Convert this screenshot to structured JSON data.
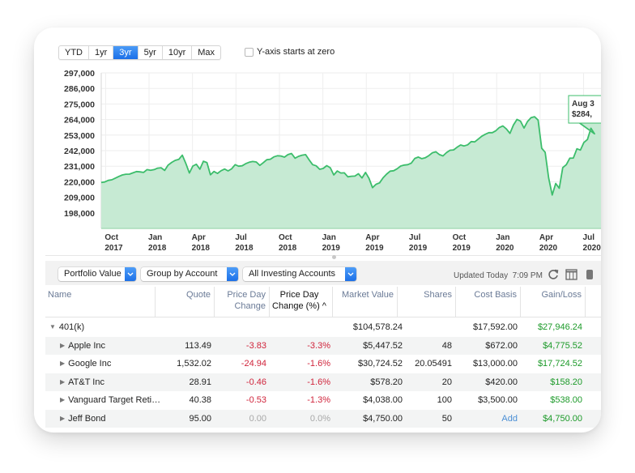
{
  "range_control": {
    "options": [
      "YTD",
      "1yr",
      "3yr",
      "5yr",
      "10yr",
      "Max"
    ],
    "selected": "3yr"
  },
  "y_axis_zero": {
    "label": "Y-axis starts at zero",
    "checked": false
  },
  "tooltip": {
    "date": "Aug 3",
    "value": "$284,"
  },
  "colors": {
    "line": "#3cbd6b",
    "fill": "#c6ead3",
    "accent": "#1a6fe8",
    "negative": "#d0243b",
    "positive": "#1c9a29"
  },
  "chart_data": {
    "type": "area",
    "title": "",
    "xlabel": "",
    "ylabel": "Portfolio Value",
    "ylim": [
      187000,
      297000
    ],
    "y_ticks": [
      "297,000",
      "286,000",
      "275,000",
      "264,000",
      "253,000",
      "242,000",
      "231,000",
      "220,000",
      "209,000",
      "198,000"
    ],
    "y_tick_values": [
      297000,
      286000,
      275000,
      264000,
      253000,
      242000,
      231000,
      220000,
      209000,
      198000
    ],
    "x_ticks": [
      {
        "month": "Oct",
        "year": "2017"
      },
      {
        "month": "Jan",
        "year": "2018"
      },
      {
        "month": "Apr",
        "year": "2018"
      },
      {
        "month": "Jul",
        "year": "2018"
      },
      {
        "month": "Oct",
        "year": "2018"
      },
      {
        "month": "Jan",
        "year": "2019"
      },
      {
        "month": "Apr",
        "year": "2019"
      },
      {
        "month": "Jul",
        "year": "2019"
      },
      {
        "month": "Oct",
        "year": "2019"
      },
      {
        "month": "Jan",
        "year": "2020"
      },
      {
        "month": "Apr",
        "year": "2020"
      },
      {
        "month": "Jul",
        "year": "2020"
      }
    ],
    "grid": true,
    "series": [
      {
        "name": "Portfolio Value",
        "x_months": [
          0,
          0.25,
          0.5,
          0.75,
          1,
          1.25,
          1.5,
          1.75,
          2,
          2.25,
          2.5,
          2.75,
          3,
          3.25,
          3.5,
          3.75,
          4,
          4.25,
          4.5,
          4.75,
          5,
          5.25,
          5.5,
          5.75,
          6,
          6.25,
          6.5,
          6.75,
          7,
          7.25,
          7.5,
          7.75,
          8,
          8.25,
          8.5,
          8.75,
          9,
          9.25,
          9.5,
          9.75,
          10,
          10.25,
          10.5,
          10.75,
          11,
          11.25,
          11.5,
          11.75,
          12,
          12.25,
          12.5,
          12.75,
          13,
          13.25,
          13.5,
          13.75,
          14,
          14.25,
          14.5,
          14.75,
          15,
          15.25,
          15.5,
          15.75,
          16,
          16.25,
          16.5,
          16.75,
          17,
          17.25,
          17.5,
          17.75,
          18,
          18.25,
          18.5,
          18.75,
          19,
          19.25,
          19.5,
          19.75,
          20,
          20.25,
          20.5,
          20.75,
          21,
          21.25,
          21.5,
          21.75,
          22,
          22.25,
          22.5,
          22.75,
          23,
          23.25,
          23.5,
          23.75,
          24,
          24.25,
          24.5,
          24.75,
          25,
          25.25,
          25.5,
          25.75,
          26,
          26.25,
          26.5,
          26.75,
          27,
          27.25,
          27.5,
          27.75,
          28,
          28.25,
          28.5,
          28.75,
          29,
          29.25,
          29.5,
          29.75,
          30,
          30.25,
          30.5,
          30.75,
          31,
          31.25,
          31.5,
          31.75,
          32,
          32.25,
          32.5,
          32.75,
          33,
          33.25,
          33.5,
          33.75,
          34,
          34.25,
          34.5,
          34.75,
          35,
          35.25,
          35.5,
          35.75
        ],
        "values": [
          219500,
          219800,
          221000,
          221400,
          222600,
          223800,
          224800,
          225300,
          225400,
          226300,
          227200,
          227000,
          226600,
          228600,
          228100,
          228600,
          229600,
          229900,
          228000,
          231800,
          233700,
          235100,
          235800,
          238800,
          233000,
          226200,
          231100,
          232400,
          228900,
          234500,
          233600,
          224900,
          227300,
          225900,
          227800,
          229000,
          227700,
          229100,
          232100,
          231000,
          231300,
          232800,
          233800,
          234300,
          234000,
          231600,
          233500,
          235600,
          235900,
          237600,
          238400,
          238200,
          237400,
          239200,
          240000,
          236700,
          238000,
          238800,
          239200,
          235500,
          232100,
          231300,
          228800,
          229400,
          231400,
          229900,
          224800,
          227600,
          226200,
          226300,
          223500,
          223900,
          224000,
          225700,
          222700,
          226600,
          222400,
          215800,
          218200,
          219200,
          222800,
          225400,
          227500,
          227800,
          229200,
          231100,
          231800,
          232100,
          233200,
          236500,
          237500,
          236300,
          237000,
          238500,
          240500,
          241200,
          239200,
          238300,
          240600,
          242300,
          242500,
          244400,
          246000,
          245300,
          246100,
          248400,
          248200,
          250200,
          252200,
          253600,
          254700,
          254700,
          256100,
          258400,
          259500,
          257300,
          254200,
          260100,
          264100,
          262900,
          258000,
          262600,
          265300,
          266000,
          263600,
          243700,
          240800,
          222700,
          210600,
          218800,
          215400,
          230000,
          232100,
          236700,
          236800,
          243300,
          242400,
          247800,
          249900,
          257800,
          253900
        ],
        "range_end_value_label": "$284,"
      }
    ]
  },
  "toolbar": {
    "view_select": "Portfolio Value",
    "group_select": "Group by Account",
    "accounts_select": "All Investing Accounts",
    "updated_label": "Updated Today",
    "updated_time": "7:09 PM"
  },
  "table": {
    "columns": [
      {
        "key": "name",
        "label": "Name",
        "line2": ""
      },
      {
        "key": "quote",
        "label": "Quote",
        "line2": ""
      },
      {
        "key": "chg",
        "label": "Price Day",
        "line2": "Change"
      },
      {
        "key": "chgp",
        "label": "Price Day",
        "line2": "Change (%) ^"
      },
      {
        "key": "mv",
        "label": "Market Value",
        "line2": ""
      },
      {
        "key": "shares",
        "label": "Shares",
        "line2": ""
      },
      {
        "key": "cost",
        "label": "Cost Basis",
        "line2": ""
      },
      {
        "key": "gain",
        "label": "Gain/Loss",
        "line2": ""
      }
    ],
    "sorted_column": "chgp",
    "group": {
      "name": "401(k)",
      "market_value": "$104,578.24",
      "cost_basis": "$17,592.00",
      "gain_loss": "$27,946.24"
    },
    "rows": [
      {
        "name": "Apple Inc",
        "quote": "113.49",
        "chg": "-3.83",
        "chgp": "-3.3%",
        "mv": "$5,447.52",
        "shares": "48",
        "cost": "$672.00",
        "gain": "$4,775.52"
      },
      {
        "name": "Google Inc",
        "quote": "1,532.02",
        "chg": "-24.94",
        "chgp": "-1.6%",
        "mv": "$30,724.52",
        "shares": "20.05491",
        "cost": "$13,000.00",
        "gain": "$17,724.52"
      },
      {
        "name": "AT&T Inc",
        "quote": "28.91",
        "chg": "-0.46",
        "chgp": "-1.6%",
        "mv": "$578.20",
        "shares": "20",
        "cost": "$420.00",
        "gain": "$158.20"
      },
      {
        "name": "Vanguard Target Reti…",
        "quote": "40.38",
        "chg": "-0.53",
        "chgp": "-1.3%",
        "mv": "$4,038.00",
        "shares": "100",
        "cost": "$3,500.00",
        "gain": "$538.00"
      },
      {
        "name": "Jeff Bond",
        "quote": "95.00",
        "chg": "0.00",
        "chgp": "0.0%",
        "mv": "$4,750.00",
        "shares": "50",
        "cost": "Add",
        "gain": "$4,750.00"
      }
    ]
  }
}
